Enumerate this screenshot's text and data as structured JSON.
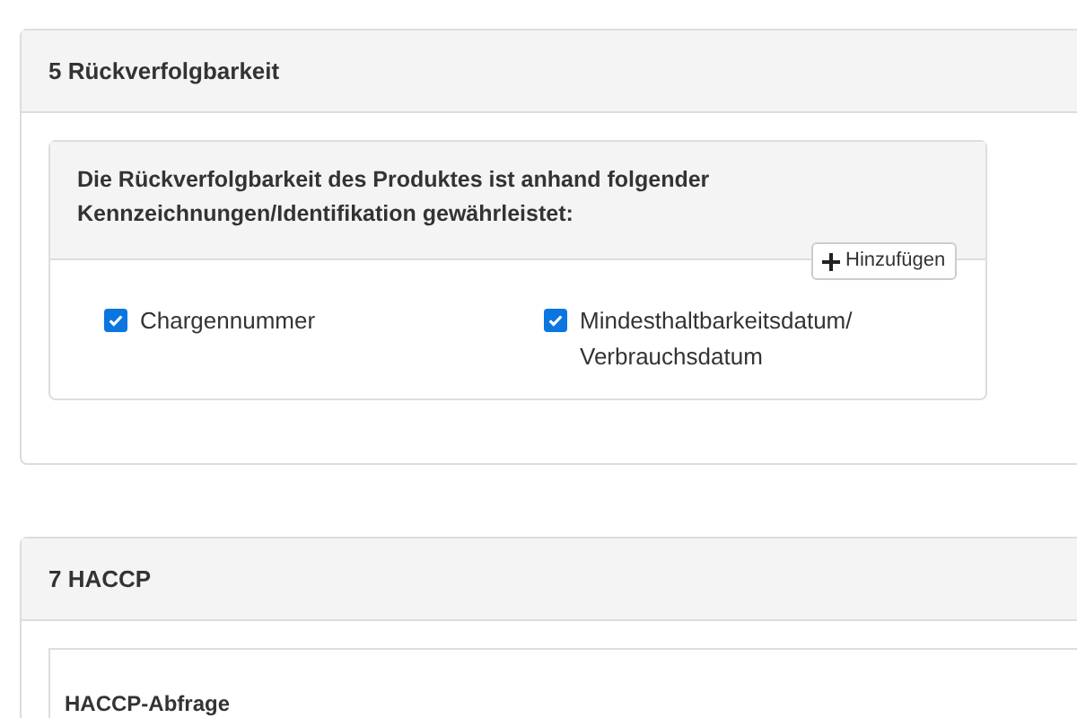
{
  "sections": [
    {
      "title": "5 Rückverfolgbarkeit",
      "question": "Die Rückverfolgbarkeit des Produktes ist anhand folgender Kennzeichnungen/Identifikation gewährleistet:",
      "add_button": "Hinzufügen",
      "options": [
        {
          "label": "Chargennummer",
          "checked": true
        },
        {
          "label": "Mindesthaltbarkeitsdatum/ Verbrauchsdatum",
          "checked": true
        }
      ]
    },
    {
      "title": "7 HACCP",
      "subtitle": "HACCP-Abfrage"
    }
  ]
}
